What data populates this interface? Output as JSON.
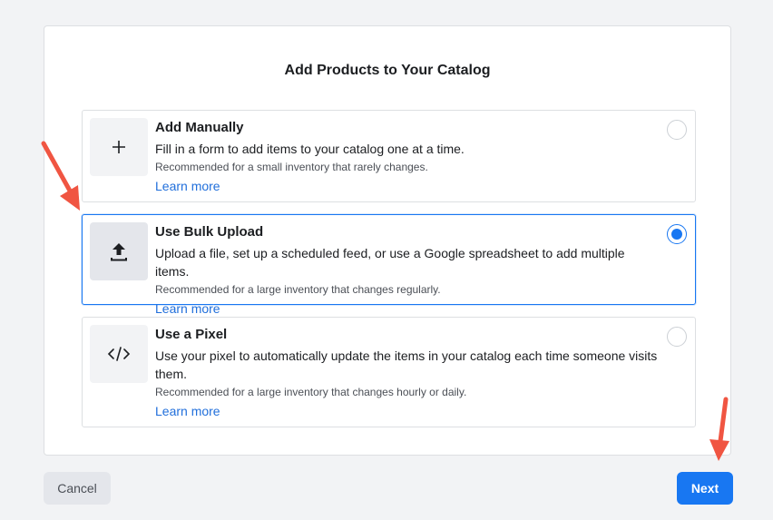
{
  "dialog": {
    "title": "Add Products to Your Catalog"
  },
  "options": [
    {
      "title": "Add Manually",
      "description": "Fill in a form to add items to your catalog one at a time.",
      "recommendation": "Recommended for a small inventory that rarely changes.",
      "link": "Learn more",
      "icon": "plus-icon",
      "selected": false
    },
    {
      "title": "Use Bulk Upload",
      "description": "Upload a file, set up a scheduled feed, or use a Google spreadsheet to add multiple items.",
      "recommendation": "Recommended for a large inventory that changes regularly.",
      "link": "Learn more",
      "icon": "upload-icon",
      "selected": true
    },
    {
      "title": "Use a Pixel",
      "description": "Use your pixel to automatically update the items in your catalog each time someone visits them.",
      "recommendation": "Recommended for a large inventory that changes hourly or daily.",
      "link": "Learn more",
      "icon": "code-icon",
      "selected": false
    }
  ],
  "footer": {
    "cancel_label": "Cancel",
    "next_label": "Next"
  },
  "colors": {
    "accent": "#1877f2",
    "link": "#216fdb",
    "annotation_arrow": "#f05542"
  }
}
